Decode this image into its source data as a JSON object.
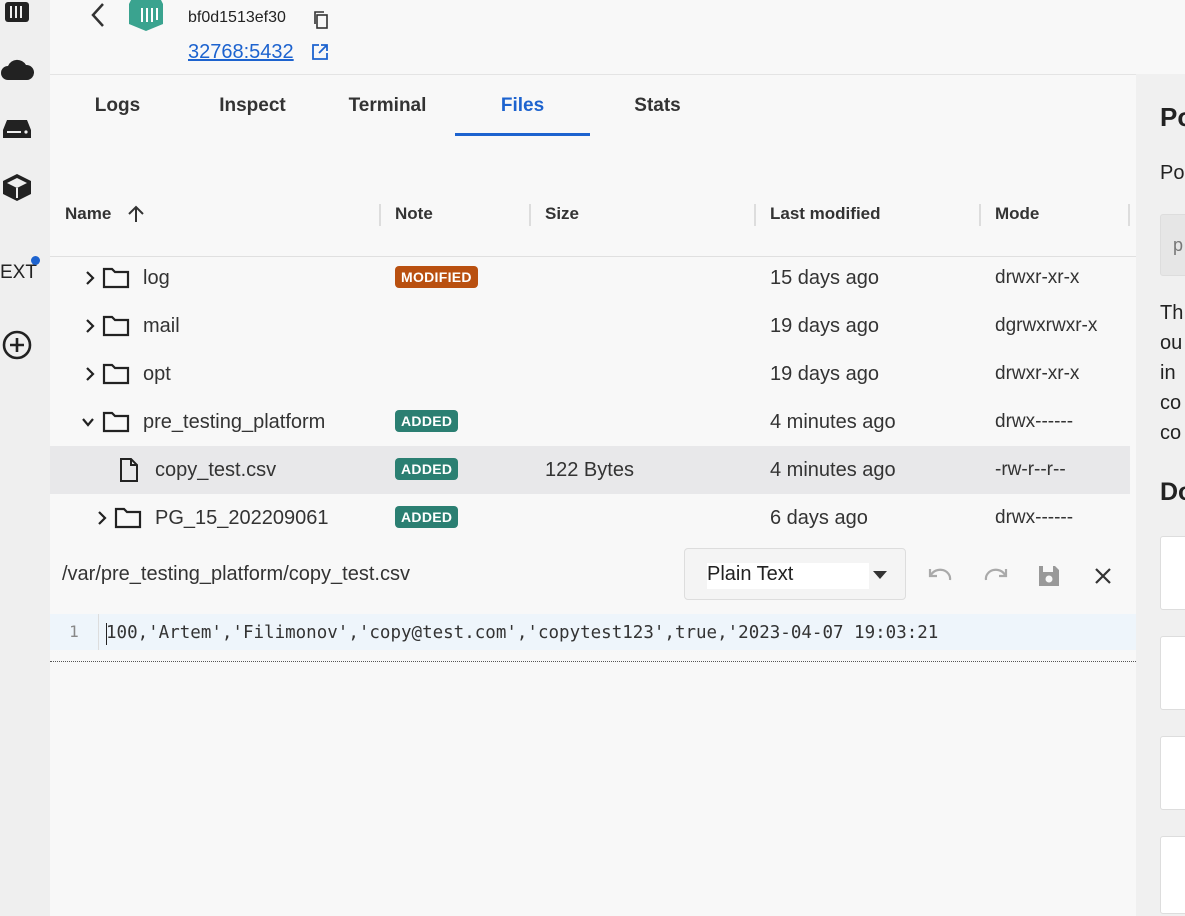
{
  "container": {
    "id": "bf0d1513ef30",
    "port": "32768:5432"
  },
  "rail": {
    "ext_label": "EXT"
  },
  "tabs": [
    "Logs",
    "Inspect",
    "Terminal",
    "Files",
    "Stats"
  ],
  "active_tab": "Files",
  "table": {
    "columns": [
      "Name",
      "Note",
      "Size",
      "Last modified",
      "Mode"
    ],
    "rows": [
      {
        "name": "log",
        "type": "folder",
        "note": "MODIFIED",
        "size": "",
        "modified": "15 days ago",
        "mode": "drwxr-xr-x"
      },
      {
        "name": "mail",
        "type": "folder",
        "note": "",
        "size": "",
        "modified": "19 days ago",
        "mode": "dgrwxrwxr-x"
      },
      {
        "name": "opt",
        "type": "folder",
        "note": "",
        "size": "",
        "modified": "19 days ago",
        "mode": "drwxr-xr-x"
      },
      {
        "name": "pre_testing_platform",
        "type": "folder-open",
        "note": "ADDED",
        "size": "",
        "modified": "4 minutes ago",
        "mode": "drwx------"
      },
      {
        "name": "copy_test.csv",
        "type": "file",
        "note": "ADDED",
        "size": "122 Bytes",
        "modified": "4 minutes ago",
        "mode": "-rw-r--r--"
      },
      {
        "name": "PG_15_202209061",
        "type": "folder",
        "note": "ADDED",
        "size": "",
        "modified": "6 days ago",
        "mode": "drwx------"
      }
    ]
  },
  "editor": {
    "path": "/var/pre_testing_platform/copy_test.csv",
    "language": "Plain Text",
    "line_number": "1",
    "line": "100,'Artem','Filimonov','copy@test.com','copytest123',true,'2023-04-07 19:03:21"
  },
  "right_panel": {
    "title": "Po",
    "label": "Po",
    "input_text": "p",
    "desc": [
      "Th",
      "ou",
      "in",
      "co",
      "co"
    ],
    "section": "Do"
  },
  "colors": {
    "accent": "#1d63cf",
    "modified": "#b95010",
    "added": "#2b7f72"
  }
}
